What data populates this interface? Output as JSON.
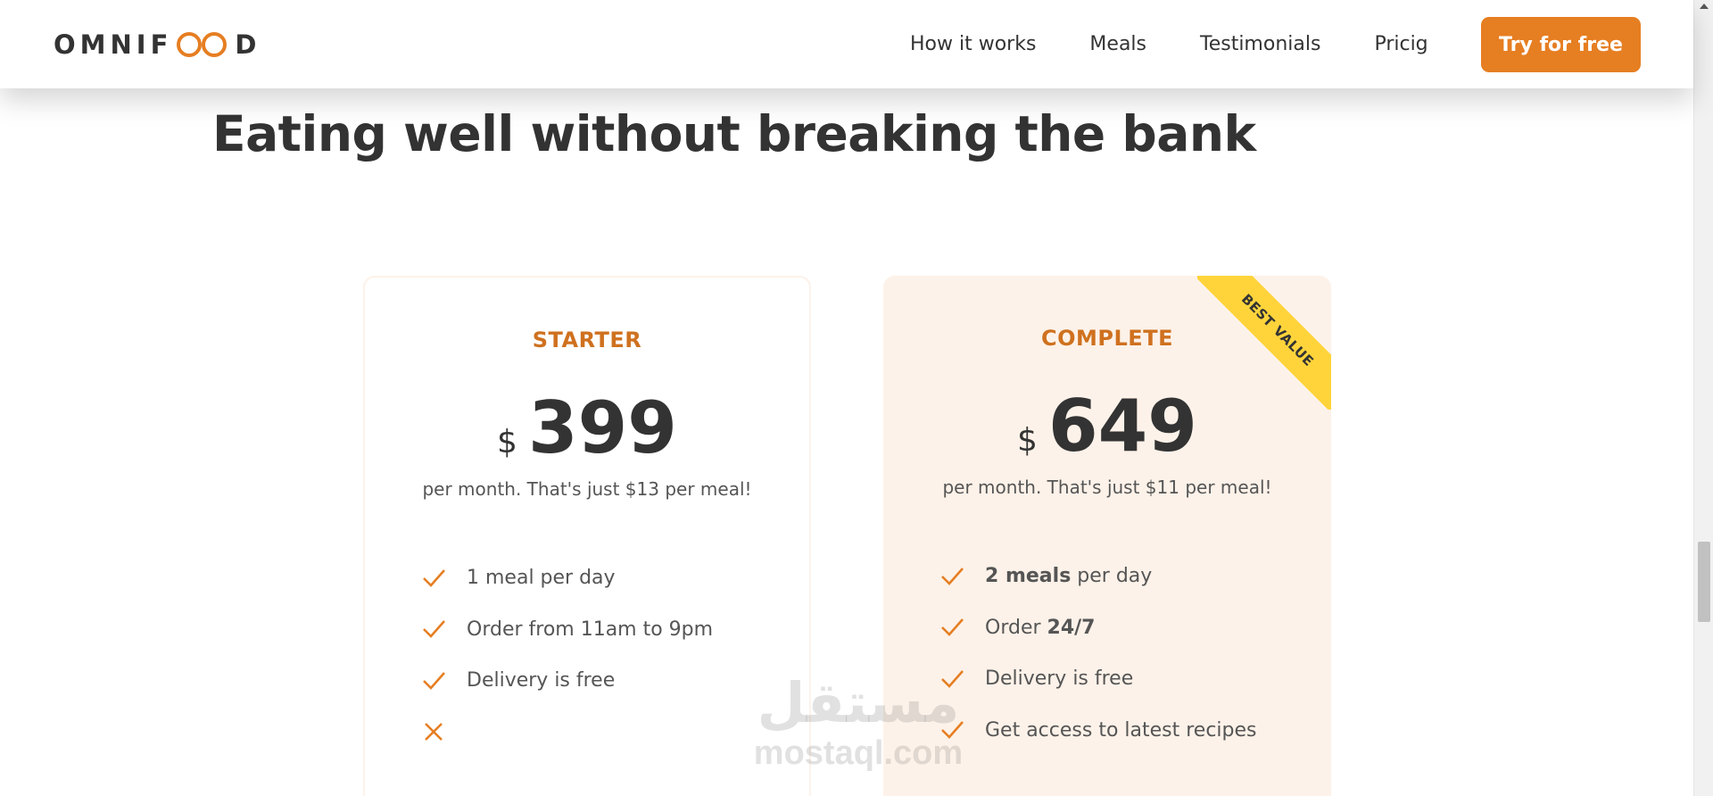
{
  "header": {
    "logo_left": "OMNIF",
    "logo_right": "D",
    "nav": [
      "How it works",
      "Meals",
      "Testimonials",
      "Pricig"
    ],
    "cta_label": "Try for free"
  },
  "section": {
    "headline": "Eating well without breaking the bank"
  },
  "plans": [
    {
      "name": "STARTER",
      "currency": "$",
      "price": "399",
      "note": "per month. That's just $13 per meal!",
      "features": [
        {
          "icon": "check-icon",
          "bold": "",
          "text": "1 meal per day"
        },
        {
          "icon": "check-icon",
          "bold": "",
          "text": "Order from 11am to 9pm"
        },
        {
          "icon": "check-icon",
          "bold": "",
          "text": "Delivery is free"
        },
        {
          "icon": "close-icon",
          "bold": "",
          "text": ""
        }
      ]
    },
    {
      "name": "COMPLETE",
      "currency": "$",
      "price": "649",
      "note": "per month. That's just $11 per meal!",
      "ribbon": "BEST VALUE",
      "features": [
        {
          "icon": "check-icon",
          "bold": "2 meals",
          "text": " per day"
        },
        {
          "icon": "check-icon",
          "text": "Order ",
          "bold_after": "24/7"
        },
        {
          "icon": "check-icon",
          "bold": "",
          "text": "Delivery is free"
        },
        {
          "icon": "check-icon",
          "bold": "",
          "text": "Get access to latest recipes"
        }
      ]
    }
  ],
  "watermark": {
    "arabic": "مستقل",
    "latin": "mostaql.com"
  },
  "colors": {
    "accent": "#e67e22",
    "accent_dark": "#cf711f",
    "card_tint": "#fdf2e9",
    "ribbon": "#ffd43b",
    "text": "#333333"
  }
}
